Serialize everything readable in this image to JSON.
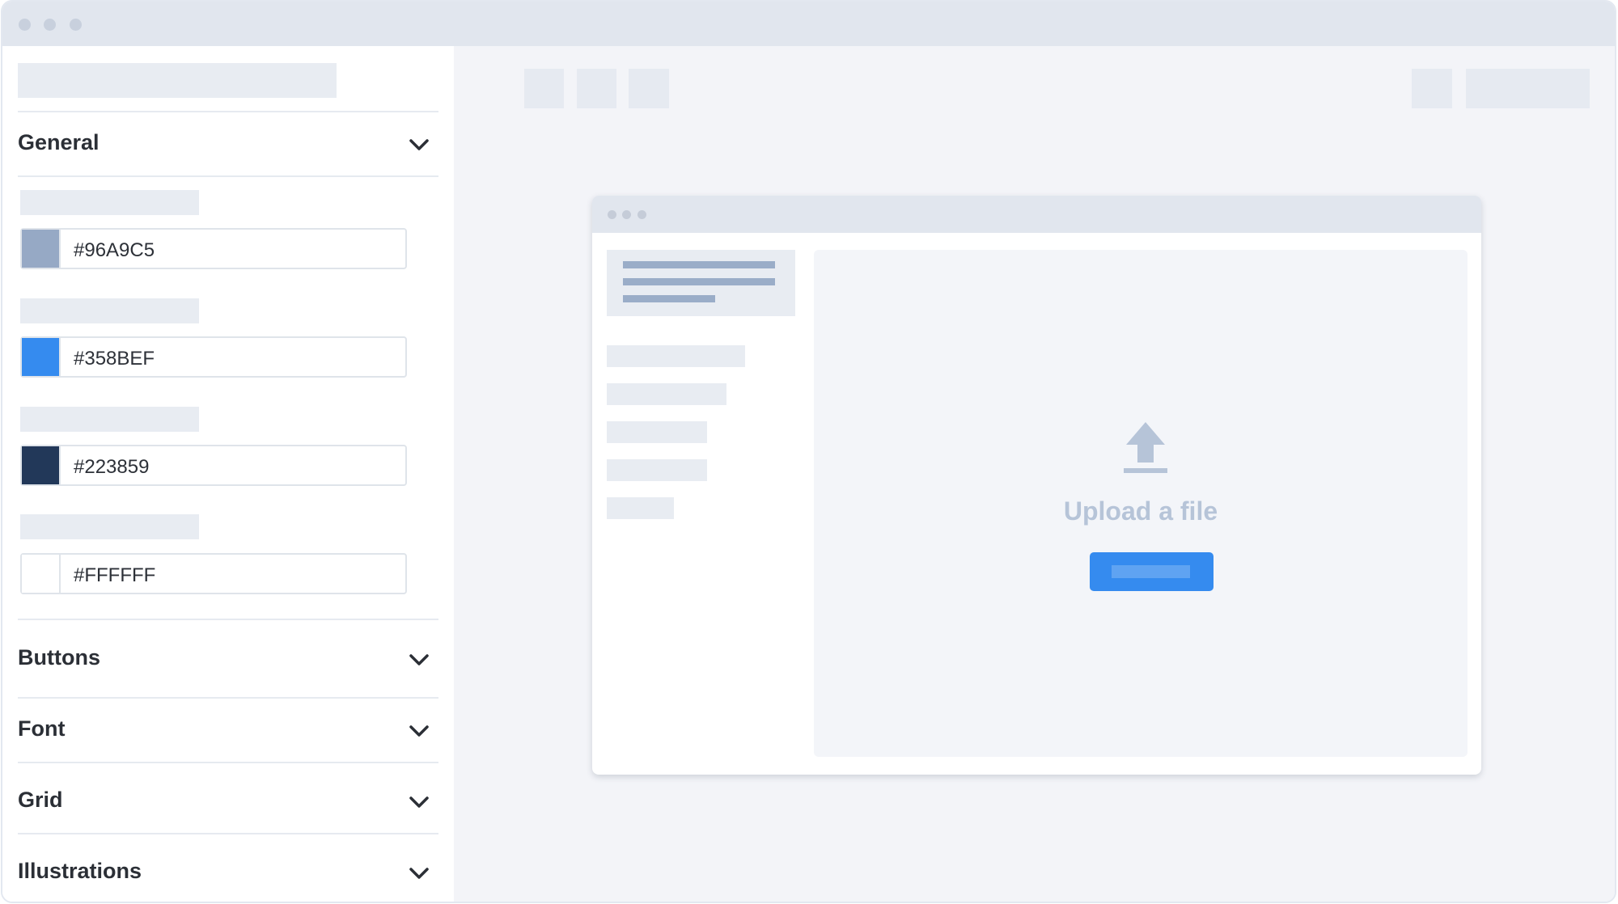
{
  "sidebar": {
    "sections": [
      {
        "title": "General"
      },
      {
        "title": "Buttons"
      },
      {
        "title": "Font"
      },
      {
        "title": "Grid"
      },
      {
        "title": "Illustrations"
      }
    ],
    "colors": [
      {
        "hex": "#96A9C5"
      },
      {
        "hex": "#358BEF"
      },
      {
        "hex": "#223859"
      },
      {
        "hex": "#FFFFFF"
      }
    ]
  },
  "preview": {
    "upload_text": "Upload a file",
    "upload_icon": "upload-arrow-icon"
  },
  "colors": {
    "accent": "#358BEF",
    "muted": "#96A9C5",
    "dark": "#223859",
    "placeholder": "#E8ECF2"
  }
}
